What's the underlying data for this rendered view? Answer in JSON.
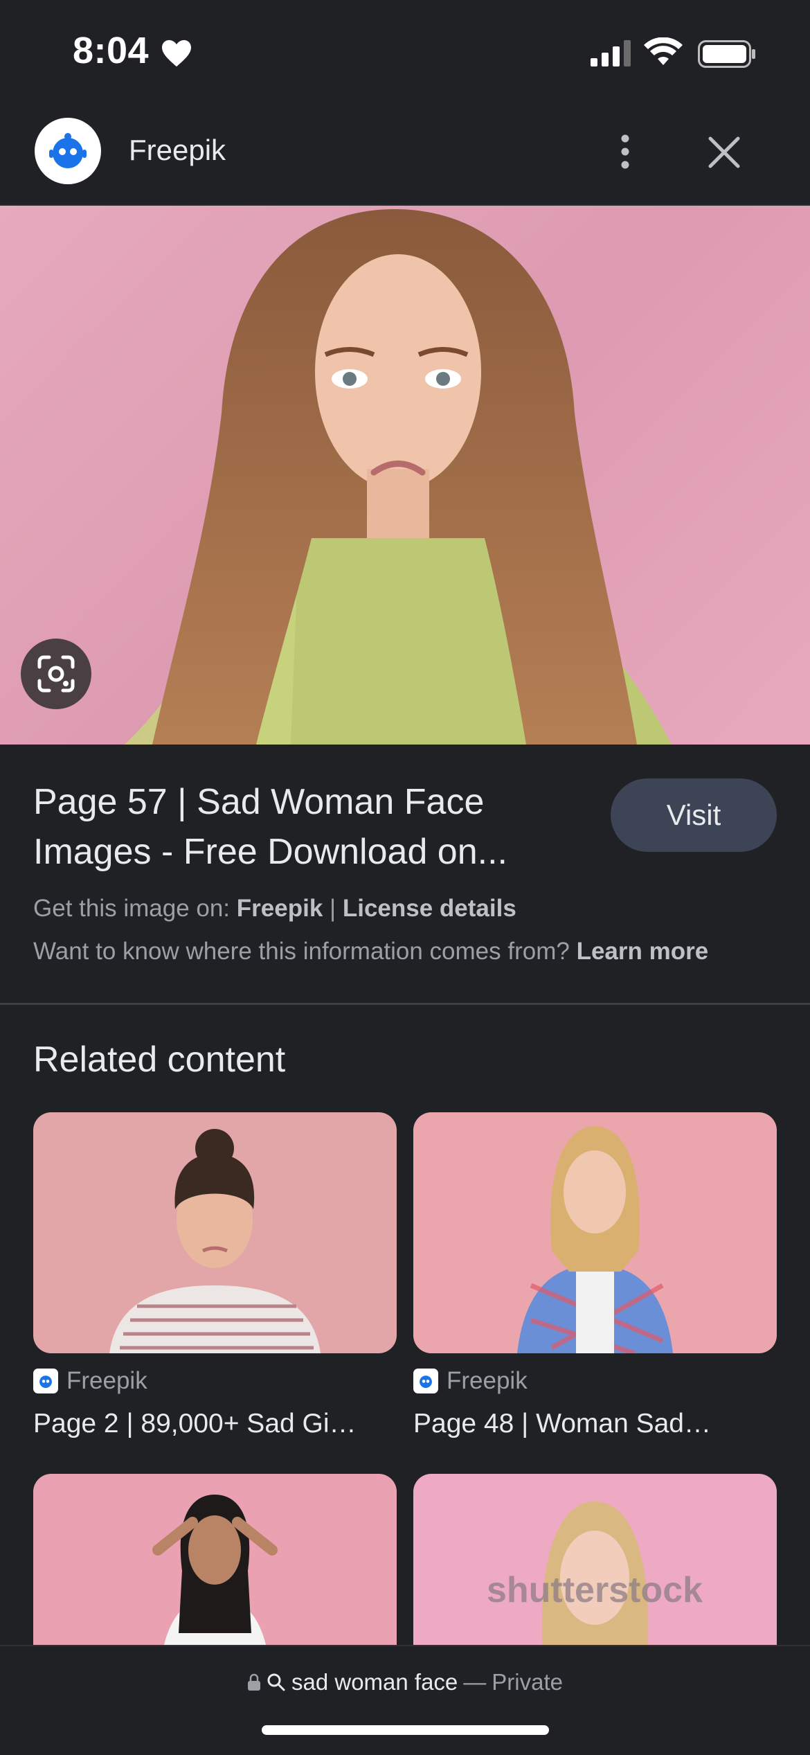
{
  "status_bar": {
    "time": "8:04"
  },
  "header": {
    "site_name": "Freepik"
  },
  "result": {
    "title_line1": "Page 57 | Sad Woman Face",
    "title_line2": "Images - Free Download on...",
    "visit_label": "Visit",
    "source_prefix": "Get this image on:",
    "source_name": "Freepik",
    "separator": "|",
    "license_label": "License details",
    "info_question": "Want to know where this information comes from?",
    "learn_more_label": "Learn more"
  },
  "related": {
    "heading": "Related content",
    "cards": [
      {
        "source": "Freepik",
        "title": "Page 2 | 89,000+ Sad Gi…"
      },
      {
        "source": "Freepik",
        "title": "Page 48 | Woman Sad…"
      },
      {
        "source": "",
        "title": ""
      },
      {
        "source": "",
        "title": ""
      }
    ],
    "watermark": "shutterstock"
  },
  "bottom_bar": {
    "query": "sad woman face",
    "dash": "—",
    "mode": "Private"
  },
  "colors": {
    "background": "#202124",
    "visit_button": "#3c4455",
    "hero_pink": "#e6a9bd"
  }
}
